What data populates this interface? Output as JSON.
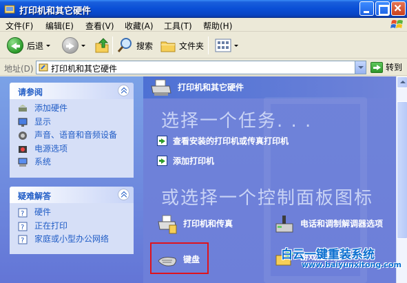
{
  "window": {
    "title": "打印机和其它硬件"
  },
  "menu": [
    "文件(F)",
    "编辑(E)",
    "查看(V)",
    "收藏(A)",
    "工具(T)",
    "帮助(H)"
  ],
  "toolbar": {
    "back": "后退",
    "search": "搜索",
    "folders": "文件夹"
  },
  "address": {
    "label": "地址(D)",
    "value": "打印机和其它硬件",
    "go": "转到"
  },
  "see_also": {
    "title": "请参阅",
    "items": [
      "添加硬件",
      "显示",
      "声音、语音和音频设备",
      "电源选项",
      "系统"
    ]
  },
  "troubleshoot": {
    "title": "疑难解答",
    "items": [
      "硬件",
      "正在打印",
      "家庭或小型办公网络"
    ]
  },
  "main": {
    "title": "打印机和其它硬件",
    "task_heading": "选择一个任务. . .",
    "tasks": [
      "查看安装的打印机或传真打印机",
      "添加打印机"
    ],
    "cp_heading": "或选择一个控制面板图标",
    "cp_items": [
      "打印机和传真",
      "电话和调制解调器选项",
      "键盘",
      "游戏控制器"
    ]
  },
  "watermark": {
    "brand": "白云一键重装系统",
    "url": "www.baiyunxitong.com"
  },
  "colors": {
    "titlebar": "#0a4fd6",
    "taskpane": "#6f83d9",
    "highlight": "#e0121b"
  }
}
